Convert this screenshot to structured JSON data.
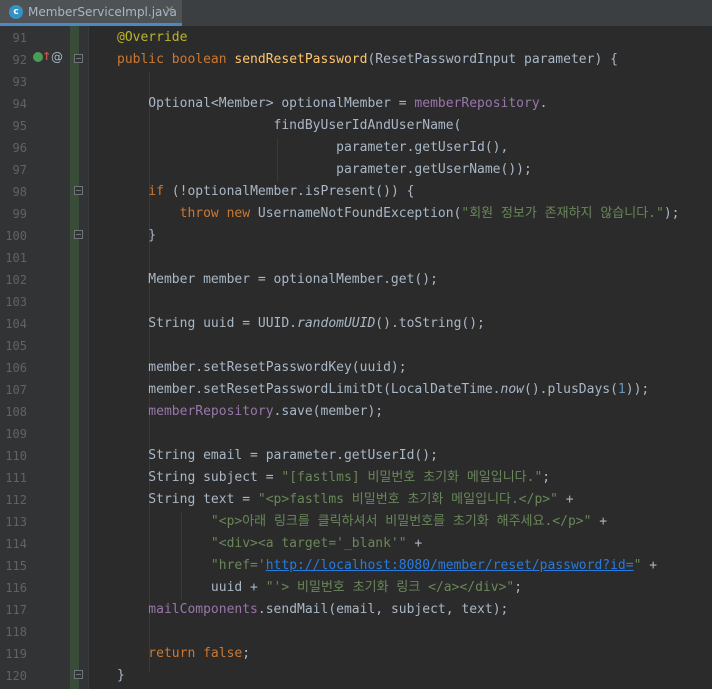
{
  "tab": {
    "label": "MemberServiceImpl.java",
    "icon_letter": "c",
    "close": "×"
  },
  "gutter_icons": {
    "implements": "implements-icon",
    "arrow": "↑",
    "annotation": "@"
  },
  "lines": [
    {
      "n": "91",
      "code": [
        [
          "t-ann",
          "@Override"
        ]
      ]
    },
    {
      "n": "92",
      "code": [
        [
          "t-kw",
          "public boolean "
        ],
        [
          "t-fn",
          "sendResetPassword"
        ],
        [
          "",
          "(ResetPasswordInput parameter) {"
        ]
      ]
    },
    {
      "n": "93",
      "code": []
    },
    {
      "n": "94",
      "code": [
        [
          "",
          "    Optional<Member> optionalMember = "
        ],
        [
          "t-fld",
          "memberRepository"
        ],
        [
          "",
          "."
        ]
      ]
    },
    {
      "n": "95",
      "code": [
        [
          "",
          "                    findByUserIdAndUserName("
        ]
      ]
    },
    {
      "n": "96",
      "code": [
        [
          "",
          "                            parameter.getUserId(),"
        ]
      ]
    },
    {
      "n": "97",
      "code": [
        [
          "",
          "                            parameter.getUserName());"
        ]
      ]
    },
    {
      "n": "98",
      "code": [
        [
          "t-kw",
          "    if "
        ],
        [
          "",
          "(!optionalMember.isPresent()) {"
        ]
      ]
    },
    {
      "n": "99",
      "code": [
        [
          "t-kw",
          "        throw new "
        ],
        [
          "",
          "UsernameNotFoundException("
        ],
        [
          "t-str",
          "\"회원 정보가 존재하지 않습니다.\""
        ],
        [
          "",
          ");"
        ]
      ]
    },
    {
      "n": "100",
      "code": [
        [
          "",
          "    }"
        ]
      ]
    },
    {
      "n": "101",
      "code": []
    },
    {
      "n": "102",
      "code": [
        [
          "",
          "    Member member = optionalMember.get();"
        ]
      ]
    },
    {
      "n": "103",
      "code": []
    },
    {
      "n": "104",
      "code": [
        [
          "",
          "    String uuid = UUID."
        ],
        [
          "t-it",
          "randomUUID"
        ],
        [
          "",
          "().toString();"
        ]
      ]
    },
    {
      "n": "105",
      "code": []
    },
    {
      "n": "106",
      "code": [
        [
          "",
          "    member.setResetPasswordKey(uuid);"
        ]
      ]
    },
    {
      "n": "107",
      "code": [
        [
          "",
          "    member.setResetPasswordLimitDt(LocalDateTime."
        ],
        [
          "t-it",
          "now"
        ],
        [
          "",
          "().plusDays("
        ],
        [
          "t-num",
          "1"
        ],
        [
          "",
          "));"
        ]
      ]
    },
    {
      "n": "108",
      "code": [
        [
          "t-fld",
          "    memberRepository"
        ],
        [
          "",
          ".save(member);"
        ]
      ]
    },
    {
      "n": "109",
      "code": []
    },
    {
      "n": "110",
      "code": [
        [
          "",
          "    String email = parameter.getUserId();"
        ]
      ]
    },
    {
      "n": "111",
      "code": [
        [
          "",
          "    String subject = "
        ],
        [
          "t-str",
          "\"[fastlms] 비밀번호 초기화 메일입니다.\""
        ],
        [
          "",
          ";"
        ]
      ]
    },
    {
      "n": "112",
      "code": [
        [
          "",
          "    String text = "
        ],
        [
          "t-str",
          "\"<p>fastlms 비밀번호 초기화 메일입니다.</p>\""
        ],
        [
          "",
          " +"
        ]
      ]
    },
    {
      "n": "113",
      "code": [
        [
          "t-str",
          "            \"<p>아래 링크를 클릭하셔서 비밀번호를 초기화 해주세요.</p>\""
        ],
        [
          "",
          " +"
        ]
      ]
    },
    {
      "n": "114",
      "code": [
        [
          "t-str",
          "            \"<div><a target='_blank'\""
        ],
        [
          "",
          " +"
        ]
      ]
    },
    {
      "n": "115",
      "code": [
        [
          "t-str",
          "            \"href='"
        ],
        [
          "t-link",
          "http://localhost:8080/member/reset/password?id="
        ],
        [
          "t-str",
          "\""
        ],
        [
          "",
          " +"
        ]
      ]
    },
    {
      "n": "116",
      "code": [
        [
          "",
          "            uuid + "
        ],
        [
          "t-str",
          "\"'> 비밀번호 초기화 링크 </a></div>\""
        ],
        [
          "",
          ";"
        ]
      ]
    },
    {
      "n": "117",
      "code": [
        [
          "t-fld",
          "    mailComponents"
        ],
        [
          "",
          ".sendMail(email, subject, text);"
        ]
      ]
    },
    {
      "n": "118",
      "code": []
    },
    {
      "n": "119",
      "code": [
        [
          "t-kw",
          "    return false"
        ],
        [
          "",
          ";"
        ]
      ]
    },
    {
      "n": "120",
      "code": [
        [
          "",
          "}"
        ]
      ]
    }
  ]
}
